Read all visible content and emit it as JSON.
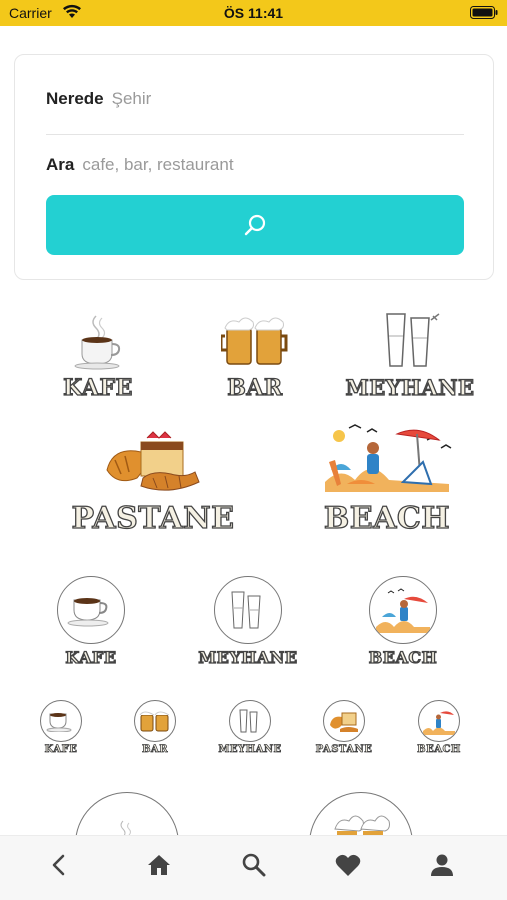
{
  "status_bar": {
    "carrier": "Carrier",
    "time": "ÖS 11:41"
  },
  "search": {
    "where_label": "Nerede",
    "where_placeholder": "Şehir",
    "find_label": "Ara",
    "find_placeholder": "cafe, bar, restaurant",
    "button_icon": "search-icon"
  },
  "categories_large": [
    {
      "label": "KAFE",
      "icon": "coffee-cup"
    },
    {
      "label": "BAR",
      "icon": "beer-mugs"
    },
    {
      "label": "MEYHANE",
      "icon": "raki-glasses"
    }
  ],
  "categories_featured": [
    {
      "label": "PASTANE",
      "icon": "pastries"
    },
    {
      "label": "BEACH",
      "icon": "beach-scene"
    }
  ],
  "categories_circle": [
    {
      "label": "KAFE",
      "icon": "coffee-cup"
    },
    {
      "label": "MEYHANE",
      "icon": "raki-glasses"
    },
    {
      "label": "BEACH",
      "icon": "beach-scene"
    }
  ],
  "categories_small": [
    {
      "label": "KAFE",
      "icon": "coffee-cup"
    },
    {
      "label": "BAR",
      "icon": "beer-mugs"
    },
    {
      "label": "MEYHANE",
      "icon": "raki-glasses"
    },
    {
      "label": "PASTANE",
      "icon": "pastries"
    },
    {
      "label": "BEACH",
      "icon": "beach-scene"
    }
  ],
  "tab_bar": [
    "back-icon",
    "home-icon",
    "search-icon",
    "heart-icon",
    "profile-icon"
  ],
  "colors": {
    "status_bar": "#f3c81a",
    "accent": "#23d0d2",
    "tab_icon": "#444444"
  }
}
